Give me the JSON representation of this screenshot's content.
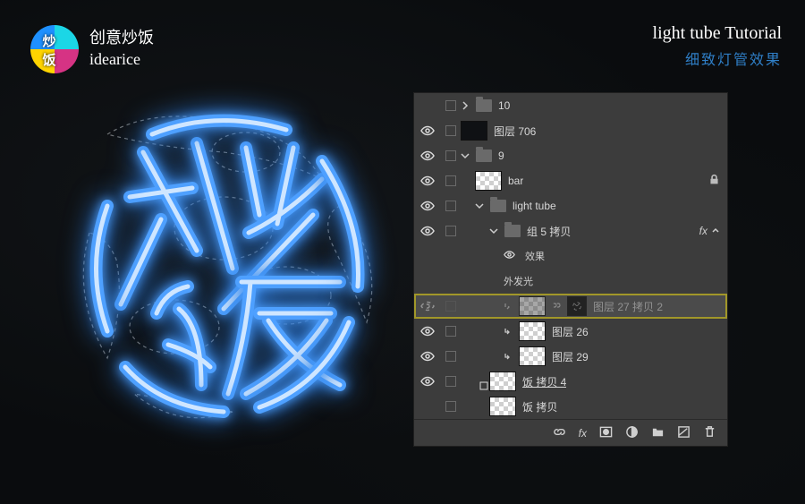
{
  "brand": {
    "zh": "创意炒饭",
    "en": "idearice"
  },
  "tutorial": {
    "en": "light tube Tutorial",
    "zh": "细致灯管效果"
  },
  "panel": {
    "rows": [
      {
        "kind": "folder",
        "label": "10",
        "eye": false,
        "expanded": false,
        "indent": 0
      },
      {
        "kind": "layer",
        "label": "图层 706",
        "eye": true,
        "thumb": "dark",
        "indent": 0
      },
      {
        "kind": "folder",
        "label": "9",
        "eye": true,
        "expanded": true,
        "indent": 0
      },
      {
        "kind": "layer",
        "label": "bar",
        "eye": true,
        "thumb": "checker",
        "indent": 1,
        "locked": true
      },
      {
        "kind": "folder",
        "label": "light tube",
        "eye": true,
        "expanded": true,
        "indent": 1
      },
      {
        "kind": "folder",
        "label": "组 5 拷贝",
        "eye": true,
        "expanded": true,
        "indent": 2,
        "fx": true
      },
      {
        "kind": "fxhead",
        "label": "效果",
        "indent": 3
      },
      {
        "kind": "fxitem",
        "label": "外发光",
        "indent": 3
      },
      {
        "kind": "layer",
        "label": "图层 27 拷贝 2",
        "eye": true,
        "thumb": "checker",
        "indent": 3,
        "clip": true,
        "mask": true,
        "selected": true
      },
      {
        "kind": "layer",
        "label": "图层 26",
        "eye": true,
        "thumb": "checker",
        "indent": 3,
        "clip": true
      },
      {
        "kind": "layer",
        "label": "图层 29",
        "eye": true,
        "thumb": "checker",
        "indent": 3,
        "clip": true
      },
      {
        "kind": "layer",
        "label": "饭 拷贝 4",
        "eye": true,
        "thumb": "checker",
        "indent": 2,
        "smart": true,
        "underline": true
      },
      {
        "kind": "layer",
        "label": "饭 拷贝",
        "eye": false,
        "thumb": "checker",
        "indent": 2
      }
    ],
    "footer": {
      "fx": "fx"
    }
  }
}
